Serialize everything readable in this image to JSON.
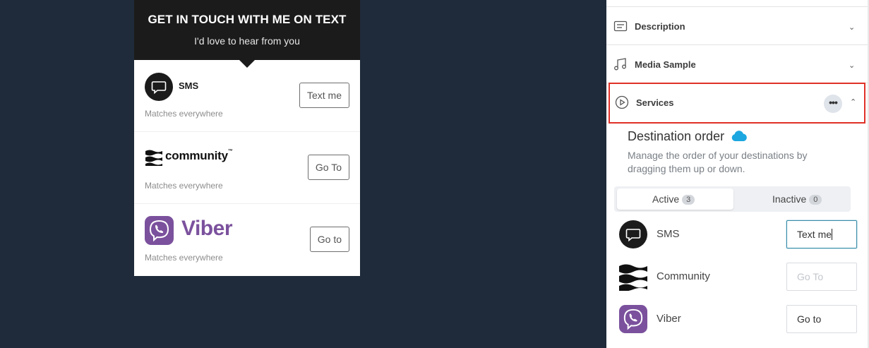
{
  "preview": {
    "title": "GET IN TOUCH WITH ME ON TEXT",
    "subtitle": "I'd love to hear from you",
    "rows": [
      {
        "name": "SMS",
        "subtext": "Matches everywhere",
        "button": "Text me"
      },
      {
        "name": "community",
        "tm": "™",
        "subtext": "Matches everywhere",
        "button": "Go To"
      },
      {
        "name": "Viber",
        "subtext": "Matches everywhere",
        "button": "Go to"
      }
    ]
  },
  "panel": {
    "accordions": [
      {
        "label": "Description",
        "icon": "text-lines-icon"
      },
      {
        "label": "Media Sample",
        "icon": "music-note-icon"
      }
    ],
    "services": {
      "label": "Services",
      "icon": "play-circle-icon",
      "more": "•••"
    },
    "destination": {
      "title": "Destination order",
      "description": "Manage the order of your destinations by dragging them up or down."
    },
    "tabs": [
      {
        "label": "Active",
        "count": "3"
      },
      {
        "label": "Inactive",
        "count": "0"
      }
    ],
    "destinations": [
      {
        "name": "SMS",
        "value": "Text me"
      },
      {
        "name": "Community",
        "placeholder": "Go To"
      },
      {
        "name": "Viber",
        "value": "Go to"
      }
    ]
  },
  "colors": {
    "background": "#1f2a3a",
    "highlight": "#e03127",
    "viber": "#7b519d",
    "cloud": "#1ca7e0"
  }
}
